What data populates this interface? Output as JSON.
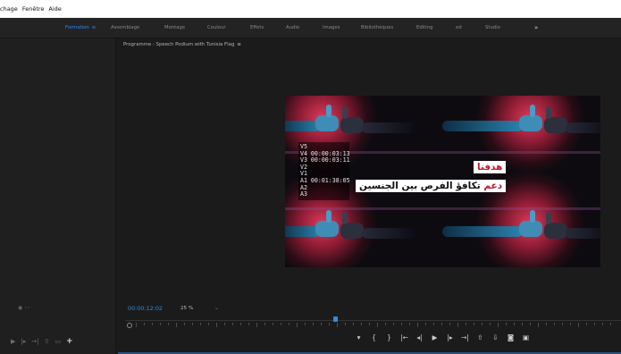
{
  "menu": [
    "chage",
    "Fenêtre",
    "Aide"
  ],
  "workspaces": {
    "items": [
      "Formation",
      "Assemblage",
      "Montage",
      "Couleur",
      "Effets",
      "Audio",
      "Images",
      "Bibliothèques",
      "Editing",
      "ed",
      "Studio"
    ],
    "active": "Formation",
    "active_menu_glyph": "≡",
    "overflow_glyph": "»"
  },
  "program_monitor": {
    "title": "Programme : Speech Podium with Tunisia Flag",
    "menu_glyph": "≡",
    "timecode_overlay": [
      "V5",
      "V4 00:00:03:13",
      "V3 00:00:03:11",
      "V2",
      "V1",
      "A1 00:01:38:05",
      "A2",
      "A3"
    ],
    "caption_line1": "هدفنا",
    "caption_line2_highlight": "دعم",
    "caption_line2_rest": " تكافؤ الفرص بين الجنسين",
    "playhead_timecode": "00:00:12:02",
    "zoom_level": "25 %",
    "zoom_arrow": "⌄",
    "playhead_fraction": 0.42
  },
  "transport_controls": [
    "add-marker",
    "mark-in",
    "mark-out",
    "go-to-in",
    "step-back",
    "play",
    "step-forward",
    "go-to-out",
    "lift",
    "extract",
    "export-frame",
    "comparison-view"
  ],
  "transport_glyphs": [
    "▾",
    "{",
    "}",
    "|←",
    "◂|",
    "▶",
    "|▸",
    "→|",
    "⇧",
    "⇩",
    "◙",
    "▣"
  ],
  "left_panel_transport_glyphs": [
    "▶",
    "|▸",
    "→|",
    "⇧",
    "▭",
    "+"
  ],
  "left_panel_zoom_glyph": "◉ ◦◦",
  "colors": {
    "accent": "#2d8ceb",
    "caption_red": "#c01930",
    "glow": "#ea3e60"
  }
}
